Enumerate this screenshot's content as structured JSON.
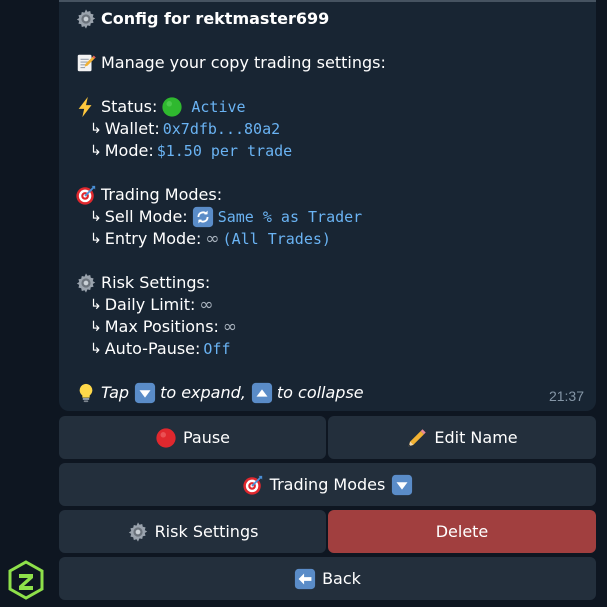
{
  "message": {
    "config_title": "Config for rektmaster699",
    "manage_text": "Manage your copy trading settings:",
    "status_label": "Status:",
    "status_value": "Active",
    "wallet_label": "Wallet:",
    "wallet_value": "0x7dfb...80a2",
    "mode_label": "Mode:",
    "mode_value": "$1.50 per trade",
    "trading_modes_label": "Trading Modes:",
    "sell_mode_label": "Sell Mode:",
    "sell_mode_value": "Same % as Trader",
    "entry_mode_label": "Entry Mode:",
    "entry_mode_symbol": "∞",
    "entry_mode_value": "(All Trades)",
    "risk_settings_label": "Risk Settings:",
    "daily_limit_label": "Daily Limit:",
    "daily_limit_value": "∞",
    "max_positions_label": "Max Positions:",
    "max_positions_value": "∞",
    "auto_pause_label": "Auto-Pause:",
    "auto_pause_value": "Off",
    "tip_tap": "Tap",
    "tip_expand": "to expand,",
    "tip_collapse": "to collapse",
    "time": "21:37",
    "arrow": "↳"
  },
  "buttons": {
    "pause": "Pause",
    "edit_name": "Edit Name",
    "trading_modes": "Trading Modes",
    "risk_settings": "Risk Settings",
    "delete": "Delete",
    "back": "Back"
  },
  "colors": {
    "background": "#0e1621",
    "bubble": "#182533",
    "button": "#232f3c",
    "delete_button": "#a13f3f",
    "code_text": "#6ab3f3",
    "timestamp": "#8596a6"
  },
  "icons": {
    "gear": "gear-icon",
    "memo": "memo-icon",
    "lightning": "lightning-icon",
    "green_circle": "green-circle-icon",
    "target": "target-icon",
    "repeat": "repeat-icon",
    "bulb": "light-bulb-icon",
    "down_button": "down-button-icon",
    "up_button": "up-button-icon",
    "red_circle": "red-circle-icon",
    "pencil": "pencil-icon",
    "back_arrow": "back-arrow-icon",
    "app_logo": "app-logo-icon"
  }
}
